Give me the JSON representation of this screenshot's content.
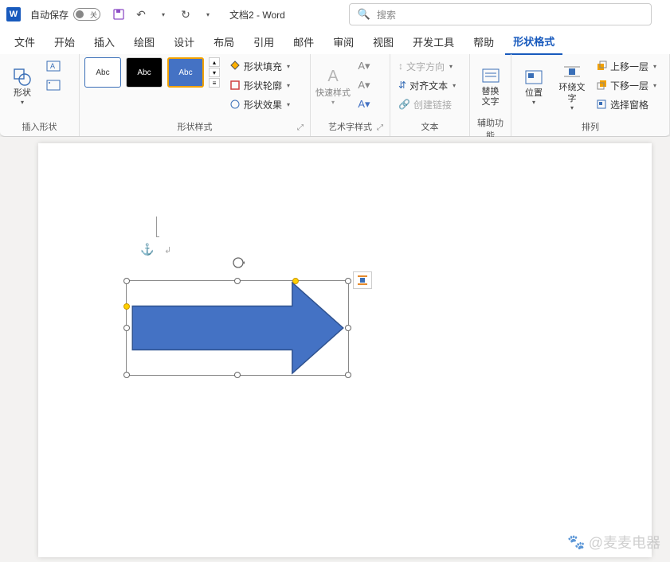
{
  "titlebar": {
    "autosave_label": "自动保存",
    "autosave_state": "关",
    "doc_title": "文档2  -  Word",
    "search_placeholder": "搜索"
  },
  "tabs": {
    "items": [
      "文件",
      "开始",
      "插入",
      "绘图",
      "设计",
      "布局",
      "引用",
      "邮件",
      "审阅",
      "视图",
      "开发工具",
      "帮助",
      "形状格式"
    ],
    "active_index": 12
  },
  "ribbon": {
    "groups": {
      "insert_shapes": {
        "label": "插入形状",
        "shapes_btn": "形状"
      },
      "shape_styles": {
        "label": "形状样式",
        "swatch_text": "Abc",
        "fill": "形状填充",
        "outline": "形状轮廓",
        "effects": "形状效果"
      },
      "wordart": {
        "label": "艺术字样式",
        "quick": "快速样式"
      },
      "text": {
        "label": "文本",
        "direction": "文字方向",
        "align": "对齐文本",
        "link": "创建链接"
      },
      "accessibility": {
        "label": "辅助功能",
        "alt": "替换\n文字"
      },
      "arrange": {
        "label": "排列",
        "position": "位置",
        "wrap": "环绕文\n字",
        "bring_fwd": "上移一层",
        "send_back": "下移一层",
        "selection_pane": "选择窗格"
      }
    }
  },
  "canvas": {
    "shape_fill": "#4472c4",
    "shape_stroke": "#2f528f"
  },
  "watermark": "@麦麦电器"
}
